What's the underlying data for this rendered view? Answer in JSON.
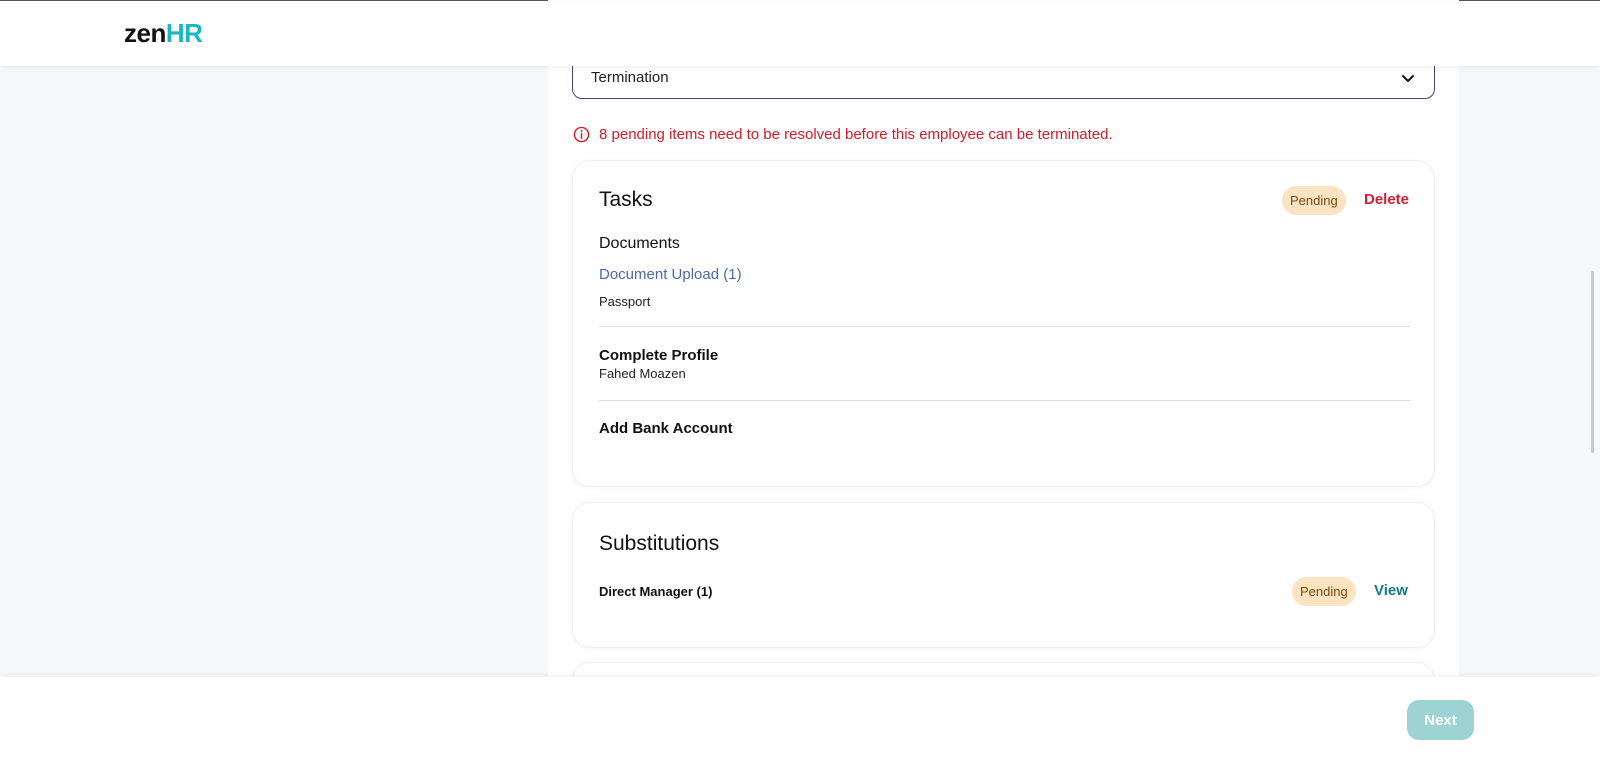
{
  "header": {
    "logo_zen": "zen",
    "logo_hr": "HR"
  },
  "form": {
    "type_select": {
      "value": "Termination"
    },
    "warning": "8 pending items need to be resolved before this employee can be terminated."
  },
  "tasks_card": {
    "title": "Tasks",
    "status": "Pending",
    "delete_label": "Delete",
    "documents_heading": "Documents",
    "document_upload_label": "Document Upload (1)",
    "document_name": "Passport",
    "complete_profile_title": "Complete Profile",
    "complete_profile_person": "Fahed Moazen",
    "bank_account_title": "Add Bank Account"
  },
  "substitutions_card": {
    "title": "Substitutions",
    "item_label": "Direct Manager (1)",
    "status": "Pending",
    "view_label": "View"
  },
  "footer": {
    "next_label": "Next"
  },
  "colors": {
    "brand_teal": "#19b6c4",
    "error_red": "#d21c2a",
    "pending_bg": "#fce3c2",
    "link_blue": "#4b6aa8",
    "view_teal": "#127b7e",
    "next_disabled": "#9ed3d3"
  }
}
